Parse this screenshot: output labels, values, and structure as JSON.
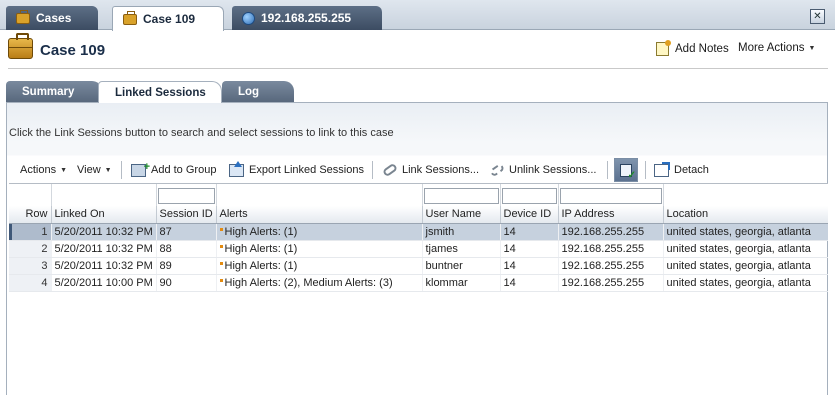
{
  "top_tabs": [
    {
      "label": "Cases",
      "icon": "briefcase-icon"
    },
    {
      "label": "Case 109",
      "icon": "briefcase-icon"
    },
    {
      "label": "192.168.255.255",
      "icon": "globe-icon"
    }
  ],
  "page": {
    "title": "Case 109",
    "add_notes": "Add Notes",
    "more_actions": "More Actions"
  },
  "sub_tabs": [
    "Summary",
    "Linked Sessions",
    "Log"
  ],
  "instruction": "Click the Link Sessions button to search and select sessions to link to this case",
  "toolbar": {
    "actions": "Actions",
    "view": "View",
    "add_to_group": "Add to Group",
    "export": "Export Linked Sessions",
    "link": "Link Sessions...",
    "unlink": "Unlink Sessions...",
    "detach": "Detach"
  },
  "table": {
    "columns": [
      "Row",
      "Linked On",
      "Session ID",
      "Alerts",
      "User Name",
      "Device ID",
      "IP Address",
      "Location"
    ],
    "rows": [
      {
        "row": "1",
        "linked_on": "5/20/2011 10:32 PM",
        "session_id": "87",
        "alerts": "High Alerts: (1)",
        "user": "jsmith",
        "device": "14",
        "ip": "192.168.255.255",
        "location": "united states, georgia, atlanta"
      },
      {
        "row": "2",
        "linked_on": "5/20/2011 10:32 PM",
        "session_id": "88",
        "alerts": "High Alerts: (1)",
        "user": "tjames",
        "device": "14",
        "ip": "192.168.255.255",
        "location": "united states, georgia, atlanta"
      },
      {
        "row": "3",
        "linked_on": "5/20/2011 10:32 PM",
        "session_id": "89",
        "alerts": "High Alerts: (1)",
        "user": "buntner",
        "device": "14",
        "ip": "192.168.255.255",
        "location": "united states, georgia, atlanta"
      },
      {
        "row": "4",
        "linked_on": "5/20/2011 10:00 PM",
        "session_id": "90",
        "alerts": "High Alerts: (2), Medium Alerts: (3)",
        "user": "klommar",
        "device": "14",
        "ip": "192.168.255.255",
        "location": "united states, georgia, atlanta"
      }
    ]
  },
  "colors": {
    "accent": "#1e4a8c",
    "tab_dark": "#3c4c62",
    "selected_row": "#c6d1de"
  }
}
